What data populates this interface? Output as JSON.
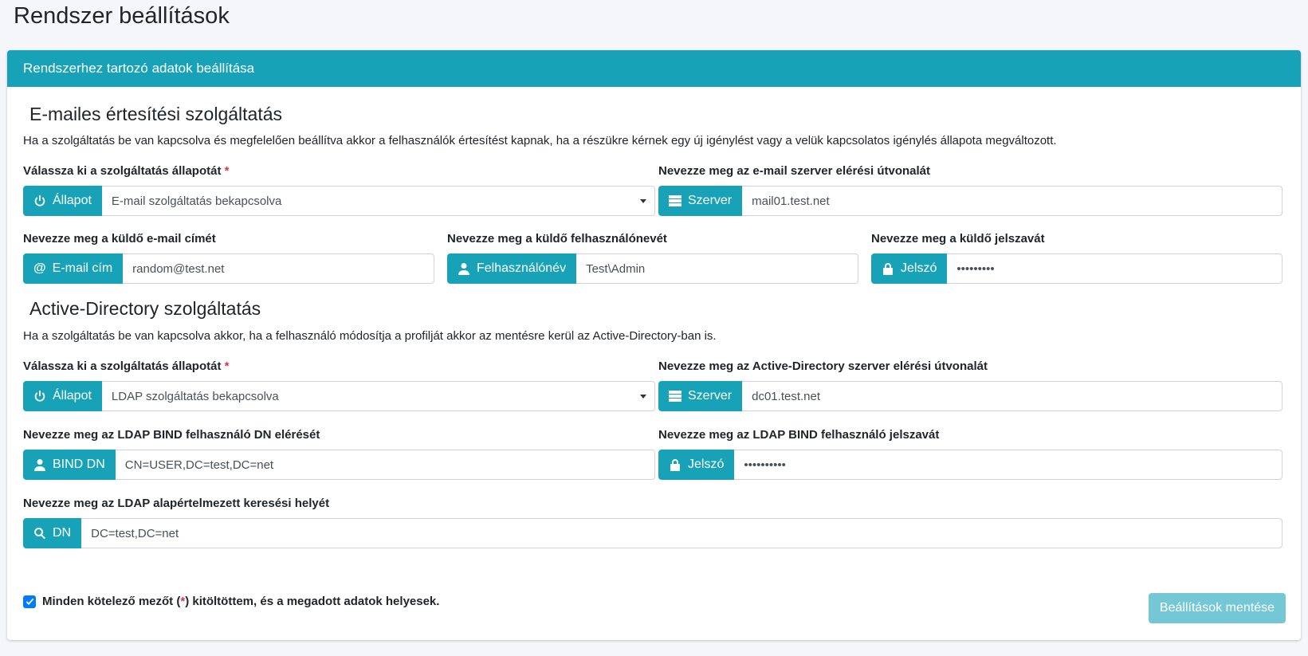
{
  "page": {
    "title": "Rendszer beállítások"
  },
  "card": {
    "header": "Rendszerhez tartozó adatok beállítása"
  },
  "email": {
    "title": "E-mailes értesítési szolgáltatás",
    "description": "Ha a szolgáltatás be van kapcsolva és megfelelően beállítva akkor a felhasználók értesítést kapnak, ha a részükre kérnek egy új igénylést vagy a velük kapcsolatos igénylés állapota megváltozott.",
    "status": {
      "label": "Válassza ki a szolgáltatás állapotát",
      "required": "*",
      "addon": "Állapot",
      "value": "E-mail szolgáltatás bekapcsolva"
    },
    "server": {
      "label": "Nevezze meg az e-mail szerver elérési útvonalát",
      "addon": "Szerver",
      "value": "mail01.test.net"
    },
    "sender_email": {
      "label": "Nevezze meg a küldő e-mail címét",
      "addon": "E-mail cím",
      "value": "random@test.net"
    },
    "sender_user": {
      "label": "Nevezze meg a küldő felhasználónevét",
      "addon": "Felhasználónév",
      "value": "Test\\Admin"
    },
    "sender_password": {
      "label": "Nevezze meg a küldő jelszavát",
      "addon": "Jelszó",
      "value": "•••••••••"
    }
  },
  "ad": {
    "title": "Active-Directory szolgáltatás",
    "description": "Ha a szolgáltatás be van kapcsolva akkor, ha a felhasználó módosítja a profilját akkor az mentésre kerül az Active-Directory-ban is.",
    "status": {
      "label": "Válassza ki a szolgáltatás állapotát",
      "required": "*",
      "addon": "Állapot",
      "value": "LDAP szolgáltatás bekapcsolva"
    },
    "server": {
      "label": "Nevezze meg az Active-Directory szerver elérési útvonalát",
      "addon": "Szerver",
      "value": "dc01.test.net"
    },
    "bind_dn": {
      "label": "Nevezze meg az LDAP BIND felhasználó DN elérését",
      "addon": "BIND DN",
      "value": "CN=USER,DC=test,DC=net"
    },
    "bind_password": {
      "label": "Nevezze meg az LDAP BIND felhasználó jelszavát",
      "addon": "Jelszó",
      "value": "••••••••••"
    },
    "search_base": {
      "label": "Nevezze meg az LDAP alapértelmezett keresési helyét",
      "addon": "DN",
      "value": "DC=test,DC=net"
    }
  },
  "confirm": {
    "text_before": "Minden kötelező mezőt (",
    "required": "*",
    "text_after": ") kitöltöttem, és a megadott adatok helyesek.",
    "checked": true
  },
  "save_button": "Beállítások mentése",
  "colors": {
    "accent": "#17a2b8",
    "checkbox": "#007bff",
    "required": "#dc3545",
    "button_disabled": "#74c7d4"
  }
}
